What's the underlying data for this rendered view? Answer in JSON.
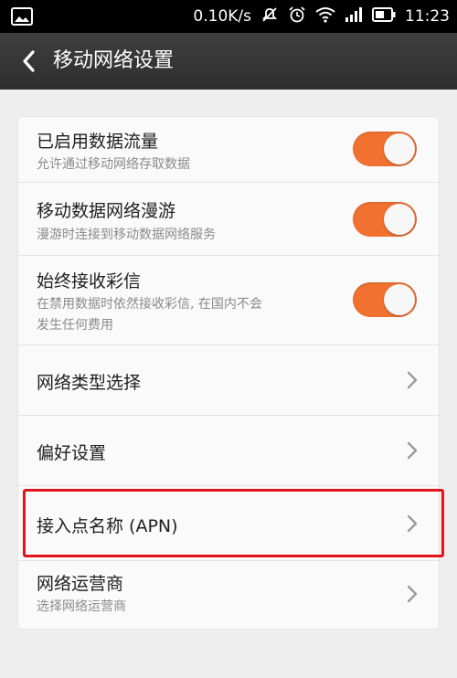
{
  "status_bar": {
    "speed": "0.10K/s",
    "time": "11:23",
    "icons": [
      "image-icon",
      "mute-icon",
      "alarm-icon",
      "wifi-icon",
      "signal-icon",
      "battery-icon"
    ]
  },
  "header": {
    "back_icon": "chevron-left-icon",
    "title": "移动网络设置"
  },
  "settings": [
    {
      "title": "已启用数据流量",
      "subtitle": "允许通过移动网络存取数据",
      "toggle": true
    },
    {
      "title": "移动数据网络漫游",
      "subtitle": "漫游时连接到移动数据网络服务",
      "toggle": true
    },
    {
      "title": "始终接收彩信",
      "subtitle_line1": "在禁用数据时依然接收彩信, 在国内不会",
      "subtitle_line2": "发生任何费用",
      "toggle": true
    },
    {
      "title": "网络类型选择",
      "chevron": true
    },
    {
      "title": "偏好设置",
      "chevron": true
    },
    {
      "title": "接入点名称 (APN)",
      "chevron": true,
      "highlighted": true
    },
    {
      "title": "网络运营商",
      "subtitle": "选择网络运营商",
      "chevron": true
    }
  ],
  "colors": {
    "toggle_on": "#f07130",
    "highlight_border": "#e3141b",
    "header_bg": "#3a3a3a"
  }
}
